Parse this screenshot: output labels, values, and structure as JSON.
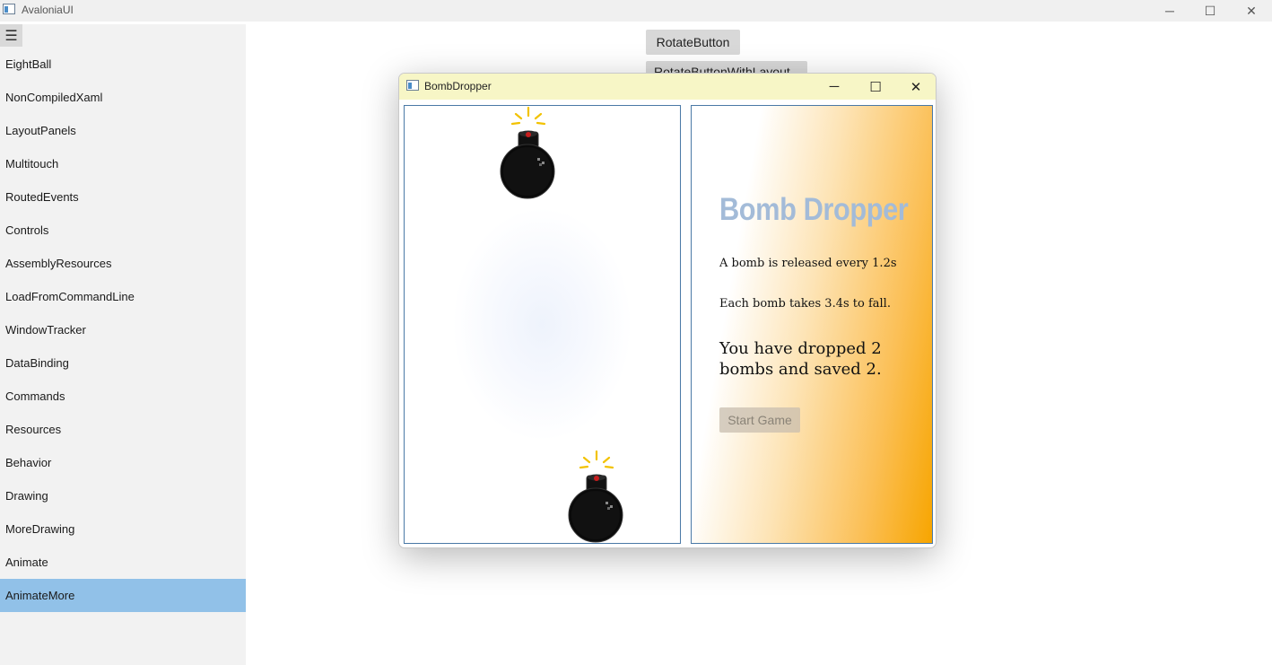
{
  "main_window": {
    "title": "AvaloniaUI",
    "controls": {
      "minimize": "─",
      "maximize": "☐",
      "close": "✕"
    }
  },
  "sidebar": {
    "menu_glyph": "☰",
    "items": [
      {
        "label": "EightBall"
      },
      {
        "label": "NonCompiledXaml"
      },
      {
        "label": "LayoutPanels"
      },
      {
        "label": "Multitouch"
      },
      {
        "label": "RoutedEvents"
      },
      {
        "label": "Controls"
      },
      {
        "label": "AssemblyResources"
      },
      {
        "label": "LoadFromCommandLine"
      },
      {
        "label": "WindowTracker"
      },
      {
        "label": "DataBinding"
      },
      {
        "label": "Commands"
      },
      {
        "label": "Resources"
      },
      {
        "label": "Behavior"
      },
      {
        "label": "Drawing"
      },
      {
        "label": "MoreDrawing"
      },
      {
        "label": "Animate"
      },
      {
        "label": "AnimateMore",
        "selected": true
      }
    ]
  },
  "content": {
    "rotate_button": "RotateButton",
    "rotate_layout_button": "RotateButtonWithLayout"
  },
  "dialog": {
    "title": "BombDropper",
    "controls": {
      "minimize": "─",
      "maximize": "☐",
      "close": "✕"
    },
    "game": {
      "heading": "Bomb Dropper",
      "release_text": "A bomb is released every 1.2s",
      "fall_text": "Each bomb takes 3.4s to fall.",
      "status_text": "You have dropped 2 bombs and saved 2.",
      "start_button": "Start Game"
    }
  },
  "colors": {
    "selected_item": "#91c1e8",
    "dialog_title_bg": "#f7f6c6",
    "panel_border": "#4a79a6",
    "accent_orange": "#f7a500",
    "heading_color": "#a3bbd8"
  }
}
